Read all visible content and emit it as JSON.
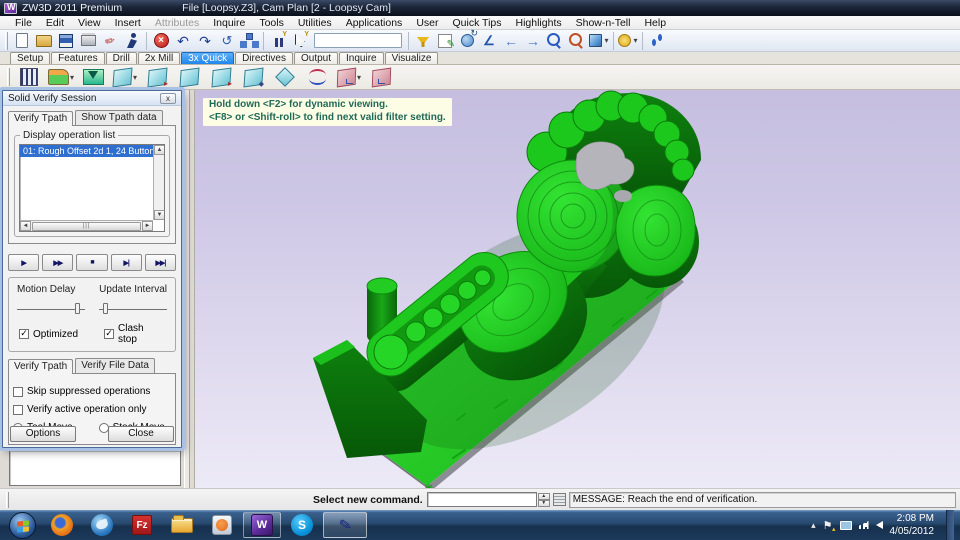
{
  "window": {
    "app_title": "ZW3D 2011 Premium",
    "doc_title": "File [Loopsy.Z3],  Cam Plan [2 - Loopsy Cam]"
  },
  "menubar": {
    "items": [
      {
        "label": "File",
        "enabled": true
      },
      {
        "label": "Edit",
        "enabled": true
      },
      {
        "label": "View",
        "enabled": true
      },
      {
        "label": "Insert",
        "enabled": true
      },
      {
        "label": "Attributes",
        "enabled": false
      },
      {
        "label": "Inquire",
        "enabled": true
      },
      {
        "label": "Tools",
        "enabled": true
      },
      {
        "label": "Utilities",
        "enabled": true
      },
      {
        "label": "Applications",
        "enabled": true
      },
      {
        "label": "User",
        "enabled": true
      },
      {
        "label": "Quick Tips",
        "enabled": true
      },
      {
        "label": "Highlights",
        "enabled": true
      },
      {
        "label": "Show-n-Tell",
        "enabled": true
      },
      {
        "label": "Help",
        "enabled": true
      }
    ]
  },
  "toolbar": {
    "icons": [
      {
        "n": "new-file"
      },
      {
        "n": "open-folder"
      },
      {
        "n": "save"
      },
      {
        "n": "print"
      },
      {
        "n": "erase-pencil"
      },
      {
        "n": "exit-session"
      },
      {
        "sep": true
      },
      {
        "n": "abort"
      },
      {
        "n": "undo"
      },
      {
        "n": "redo"
      },
      {
        "n": "regen"
      },
      {
        "n": "assembly-tree"
      },
      {
        "sep": true
      },
      {
        "n": "filter-bars"
      },
      {
        "n": "filter-cursor"
      },
      {
        "n": "quick-input",
        "box": true
      },
      {
        "sep": true
      },
      {
        "n": "funnel"
      },
      {
        "n": "sketch-edit"
      },
      {
        "n": "rotate-view"
      },
      {
        "n": "angle-snap"
      },
      {
        "n": "view-back"
      },
      {
        "n": "view-forward"
      },
      {
        "n": "zoom-window"
      },
      {
        "n": "zoom-all"
      },
      {
        "n": "shaded-cube",
        "dd": true
      },
      {
        "sep": true
      },
      {
        "n": "render-sun",
        "dd": true
      },
      {
        "sep": true
      },
      {
        "n": "footsteps"
      }
    ]
  },
  "ribbon": {
    "tabs": [
      "Setup",
      "Features",
      "Drill",
      "2x Mill",
      "3x Quick",
      "Directives",
      "Output",
      "Inquire",
      "Visualize"
    ],
    "active_tab": "3x Quick"
  },
  "cam_toolbar": {
    "icons": [
      {
        "n": "tool-cutter",
        "k": "cutter"
      },
      {
        "n": "rough-offset",
        "k": "rough",
        "dd": true
      },
      {
        "n": "valley-finish",
        "k": "valley"
      },
      {
        "n": "surface-op-a",
        "k": "teal",
        "dd": true
      },
      {
        "n": "surface-op-b",
        "k": "teal2"
      },
      {
        "n": "surface-op-c",
        "k": "teal"
      },
      {
        "n": "surface-op-d",
        "k": "teal2"
      },
      {
        "n": "surface-op-e",
        "k": "teal3"
      },
      {
        "n": "surface-op-f",
        "k": "diamond"
      },
      {
        "n": "curve-op",
        "k": "curves"
      },
      {
        "n": "output-op-a",
        "k": "red",
        "dd": true
      },
      {
        "n": "output-op-b",
        "k": "red"
      }
    ]
  },
  "dialog": {
    "title": "Solid Verify Session",
    "close_glyph": "x",
    "tabs_top": [
      "Verify Tpath",
      "Show Tpath data"
    ],
    "operation_group_label": "Display operation list",
    "operations": [
      "01: Rough Offset 2d 1, 24 Button"
    ],
    "playback": {
      "play": "▶",
      "ffwd": "▶▶",
      "stop": "■",
      "step": "▶|",
      "end": "▶▶|"
    },
    "motion_delay_label": "Motion Delay",
    "update_interval_label": "Update Interval",
    "optimized_label": "Optimized",
    "clash_stop_label": "Clash stop",
    "tabs_bottom": [
      "Verify Tpath",
      "Verify File Data"
    ],
    "skip_label": "Skip suppressed operations",
    "active_only_label": "Verify active operation only",
    "tool_move_label": "Tool Move",
    "stock_move_label": "Stock Move",
    "options_button": "Options",
    "close_button": "Close"
  },
  "viewport": {
    "hint_line1": "Hold down <F2> for dynamic viewing.",
    "hint_line2": "<F8> or <Shift-roll> to find next valid filter setting.",
    "model_color": "#1fc81f",
    "stock_color": "#b4b4ba",
    "background_top": "#c5bedf",
    "background_bottom": "#edeaf7"
  },
  "command_bar": {
    "prompt": "Select new command.",
    "input_value": "",
    "message": "MESSAGE: Reach the end of verification."
  },
  "taskbar": {
    "items": [
      {
        "n": "start-button",
        "k": "start",
        "active": false
      },
      {
        "n": "firefox",
        "k": "firefox",
        "active": false
      },
      {
        "n": "thunderbird",
        "k": "thunderbird",
        "active": false
      },
      {
        "n": "filezilla",
        "k": "filezilla",
        "glyph": "Fz",
        "active": false
      },
      {
        "n": "windows-explorer",
        "k": "explorer",
        "active": false
      },
      {
        "n": "media-player",
        "k": "media",
        "active": false
      },
      {
        "n": "zw3d-app",
        "k": "zw3d",
        "glyph": "W",
        "active": true
      },
      {
        "n": "skype",
        "k": "skype",
        "glyph": "S",
        "active": false
      },
      {
        "n": "zw3d-window",
        "k": "pen",
        "glyph": "✎",
        "active": true,
        "pressed": true
      }
    ],
    "tray": {
      "time": "2:08 PM",
      "date": "4/05/2012"
    }
  }
}
